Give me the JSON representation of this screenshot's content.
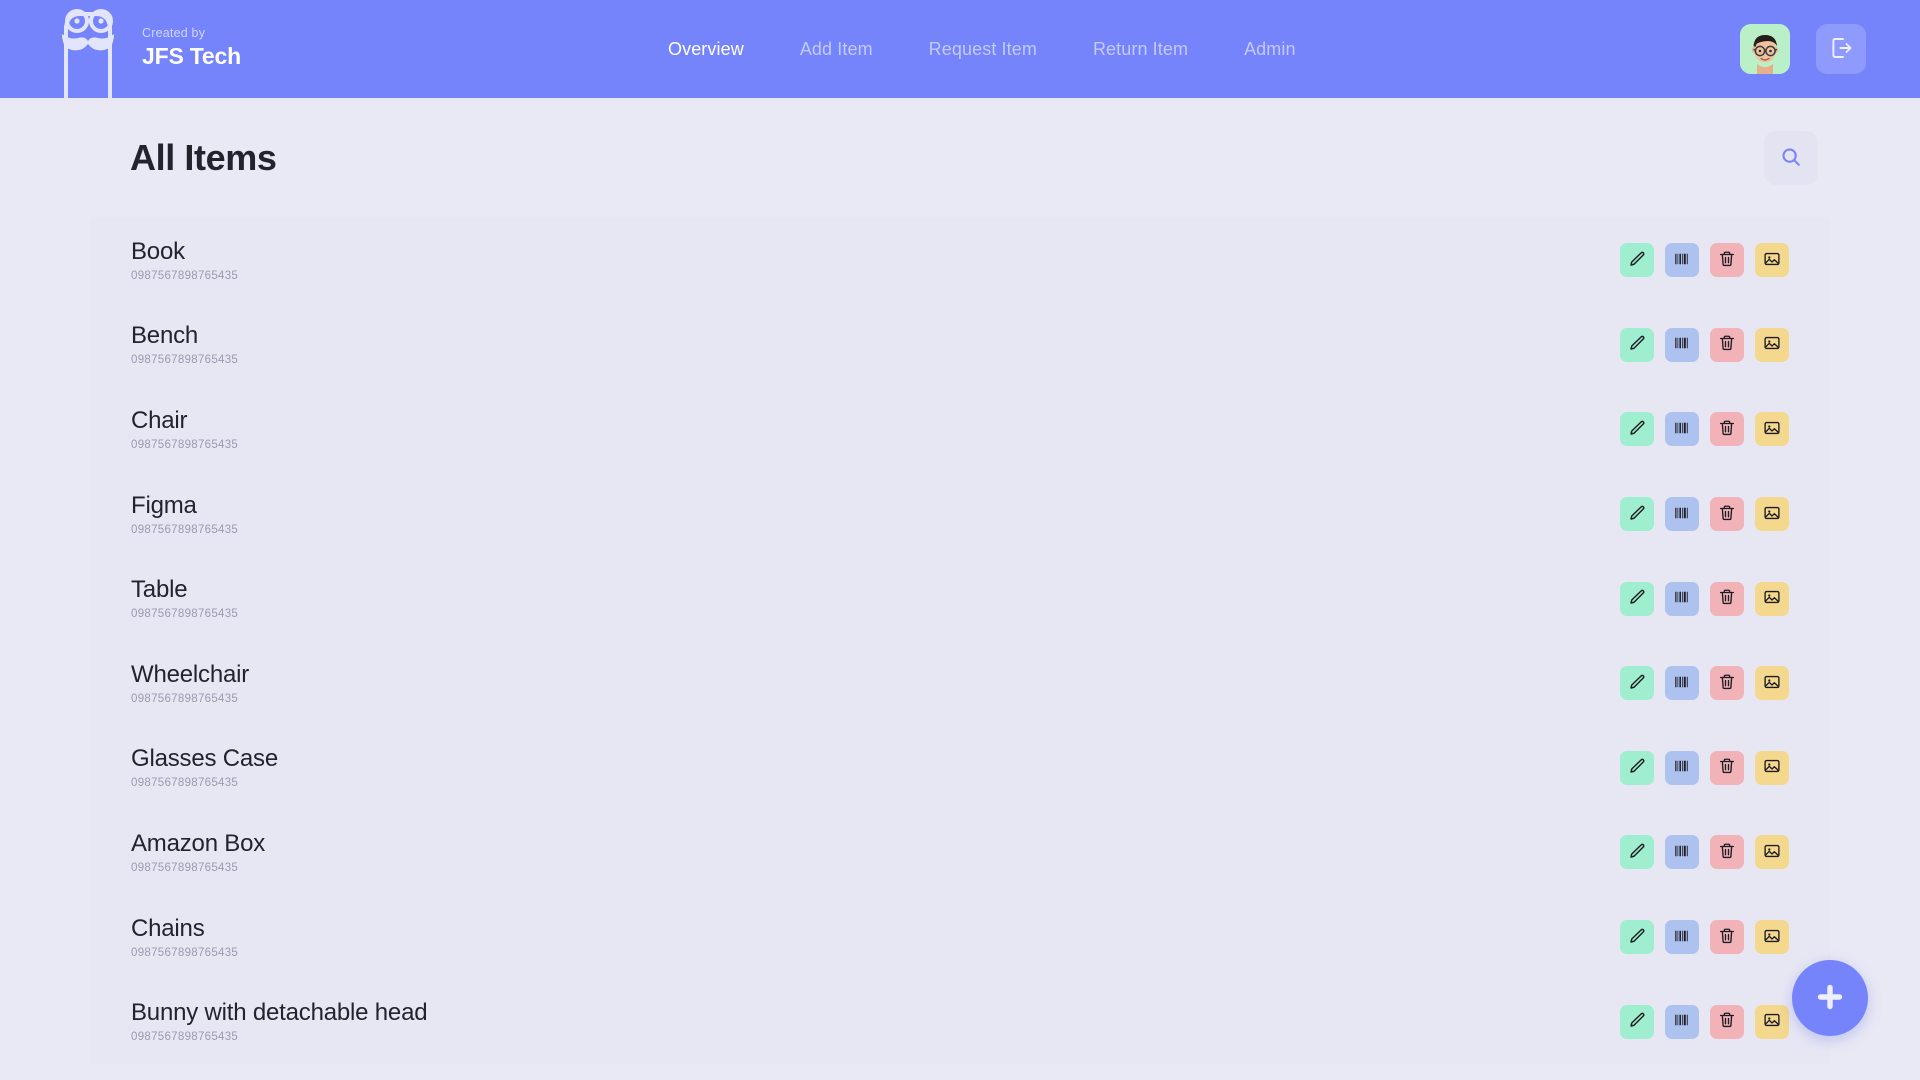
{
  "navbar": {
    "brand": {
      "created_by_label": "Created by",
      "name": "JFS Tech",
      "logo_icon": "mustache-glasses-logo-icon"
    },
    "links": [
      {
        "label": "Overview",
        "active": true
      },
      {
        "label": "Add Item",
        "active": false
      },
      {
        "label": "Request Item",
        "active": false
      },
      {
        "label": "Return Item",
        "active": false
      },
      {
        "label": "Admin",
        "active": false
      }
    ],
    "avatar_icon": "user-avatar-memoji",
    "logout_icon": "logout-icon",
    "background_color": "#7584fb",
    "active_link_color": "#ffffff",
    "inactive_link_color": "#c2caff"
  },
  "page": {
    "title": "All Items",
    "search_icon": "search-icon",
    "background_color": "#e9e9f5"
  },
  "actions": {
    "edit_icon": "pencil-icon",
    "barcode_icon": "barcode-icon",
    "delete_icon": "trash-icon",
    "image_icon": "image-icon",
    "edit_color": "#9eeecf",
    "barcode_color": "#aec2f0",
    "delete_color": "#f1b2b8",
    "image_color": "#f4d88e"
  },
  "fab": {
    "icon": "plus-icon",
    "color": "#7584fb"
  },
  "items": [
    {
      "name": "Book",
      "code": "0987567898765435"
    },
    {
      "name": "Bench",
      "code": "0987567898765435"
    },
    {
      "name": "Chair",
      "code": "0987567898765435"
    },
    {
      "name": "Figma",
      "code": "0987567898765435"
    },
    {
      "name": "Table",
      "code": "0987567898765435"
    },
    {
      "name": "Wheelchair",
      "code": "0987567898765435"
    },
    {
      "name": "Glasses Case",
      "code": "0987567898765435"
    },
    {
      "name": "Amazon Box",
      "code": "0987567898765435"
    },
    {
      "name": "Chains",
      "code": "0987567898765435"
    },
    {
      "name": "Bunny with detachable head",
      "code": "0987567898765435"
    }
  ]
}
